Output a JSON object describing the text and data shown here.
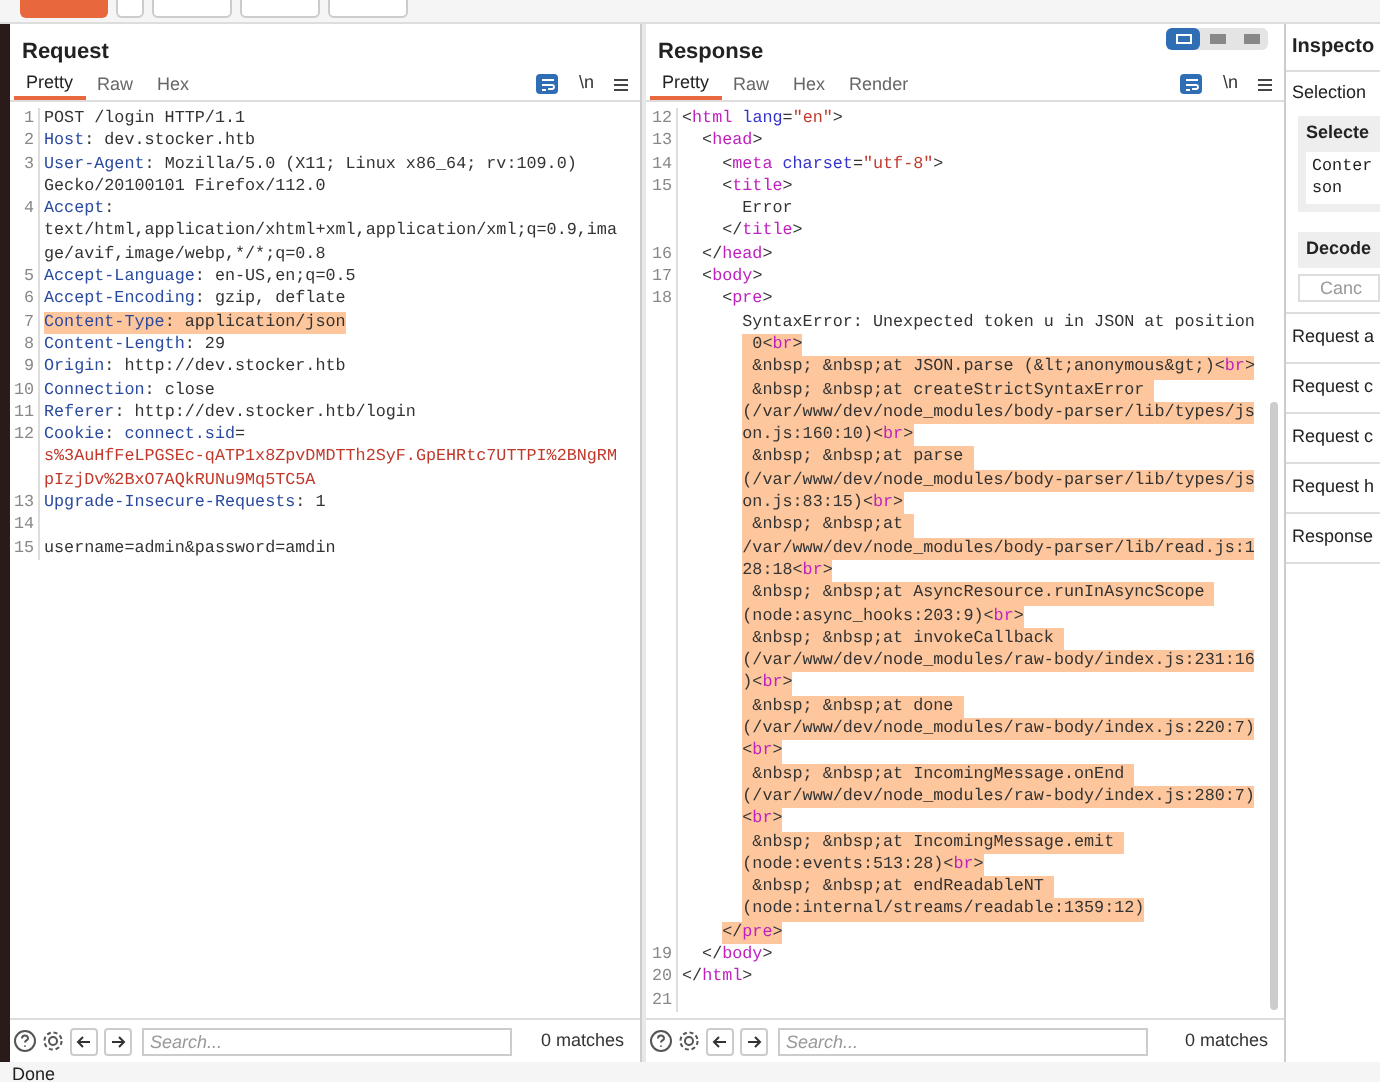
{
  "toolbar": {
    "buttons": [
      {
        "kind": "primary"
      },
      {
        "kind": "gear"
      },
      {
        "kind": "plain"
      },
      {
        "kind": "plain"
      },
      {
        "kind": "plain"
      }
    ]
  },
  "request": {
    "title": "Request",
    "tabs": [
      {
        "label": "Pretty",
        "selected": true
      },
      {
        "label": "Raw",
        "selected": false
      },
      {
        "label": "Hex",
        "selected": false
      }
    ],
    "wrap_on": true,
    "newline_label": "\\n",
    "rows": [
      {
        "n": "1",
        "hl": false,
        "seg": [
          {
            "text": "POST /login HTTP/1.1",
            "kind": "plain"
          }
        ]
      },
      {
        "n": "2",
        "hl": false,
        "seg": [
          {
            "text": "Host",
            "kind": "key"
          },
          {
            "text": ": dev.stocker.htb",
            "kind": "plain"
          }
        ]
      },
      {
        "n": "3",
        "hl": false,
        "seg": [
          {
            "text": "User-Agent",
            "kind": "key"
          },
          {
            "text": ": Mozilla/5.0 (X11; Linux x86_64; rv:109.0)",
            "kind": "plain"
          }
        ]
      },
      {
        "hl": false,
        "seg": [
          {
            "text": "Gecko/20100101 Firefox/112.0",
            "kind": "plain"
          }
        ]
      },
      {
        "n": "4",
        "hl": false,
        "seg": [
          {
            "text": "Accept",
            "kind": "key"
          },
          {
            "text": ":",
            "kind": "plain"
          }
        ]
      },
      {
        "hl": false,
        "seg": [
          {
            "text": "text/html,application/xhtml+xml,application/xml;q=0.9,ima",
            "kind": "plain"
          }
        ]
      },
      {
        "hl": false,
        "seg": [
          {
            "text": "ge/avif,image/webp,*/*;q=0.8",
            "kind": "plain"
          }
        ]
      },
      {
        "n": "5",
        "hl": false,
        "seg": [
          {
            "text": "Accept-Language",
            "kind": "key"
          },
          {
            "text": ": en-US,en;q=0.5",
            "kind": "plain"
          }
        ]
      },
      {
        "n": "6",
        "hl": false,
        "seg": [
          {
            "text": "Accept-Encoding",
            "kind": "key"
          },
          {
            "text": ": gzip, deflate",
            "kind": "plain"
          }
        ]
      },
      {
        "n": "7",
        "hl": true,
        "seg": [
          {
            "text": "Content-Type",
            "kind": "key"
          },
          {
            "text": ": application/json",
            "kind": "plain"
          }
        ]
      },
      {
        "n": "8",
        "hl": false,
        "seg": [
          {
            "text": "Content-Length",
            "kind": "key"
          },
          {
            "text": ": 29",
            "kind": "plain"
          }
        ]
      },
      {
        "n": "9",
        "hl": false,
        "seg": [
          {
            "text": "Origin",
            "kind": "key"
          },
          {
            "text": ": http://dev.stocker.htb",
            "kind": "plain"
          }
        ]
      },
      {
        "n": "10",
        "hl": false,
        "seg": [
          {
            "text": "Connection",
            "kind": "key"
          },
          {
            "text": ": close",
            "kind": "plain"
          }
        ]
      },
      {
        "n": "11",
        "hl": false,
        "seg": [
          {
            "text": "Referer",
            "kind": "key"
          },
          {
            "text": ": http://dev.stocker.htb/login",
            "kind": "plain"
          }
        ]
      },
      {
        "n": "12",
        "hl": false,
        "seg": [
          {
            "text": "Cookie",
            "kind": "key"
          },
          {
            "text": ": ",
            "kind": "plain"
          },
          {
            "text": "connect.sid",
            "kind": "key"
          },
          {
            "text": "=",
            "kind": "plain"
          }
        ]
      },
      {
        "hl": false,
        "seg": [
          {
            "text": "s%3AuHfFeLPGSEc-qATP1x8ZpvDMDTTh2SyF.GpEHRtc7UTTPI%2BNgRM",
            "kind": "value"
          }
        ]
      },
      {
        "hl": false,
        "seg": [
          {
            "text": "pIzjDv%2BxO7AQkRUNu9Mq5TC5A",
            "kind": "value"
          }
        ]
      },
      {
        "n": "13",
        "hl": false,
        "seg": [
          {
            "text": "Upgrade-Insecure-Requests",
            "kind": "key"
          },
          {
            "text": ": 1",
            "kind": "plain"
          }
        ]
      },
      {
        "n": "14",
        "hl": false,
        "seg": []
      },
      {
        "n": "15",
        "hl": false,
        "seg": [
          {
            "text": "username=admin&password=amdin",
            "kind": "plain"
          }
        ]
      }
    ],
    "search": {
      "placeholder": "Search...",
      "matches": "0 matches"
    }
  },
  "response": {
    "title": "Response",
    "layout_buttons": [
      {
        "selected": true
      },
      {
        "selected": false
      },
      {
        "selected": false
      }
    ],
    "tabs": [
      {
        "label": "Pretty",
        "selected": true
      },
      {
        "label": "Raw",
        "selected": false
      },
      {
        "label": "Hex",
        "selected": false
      },
      {
        "label": "Render",
        "selected": false
      }
    ],
    "wrap_on": true,
    "newline_label": "\\n",
    "rows": [
      {
        "n": "12",
        "hl": false,
        "seg": [
          {
            "text": "<",
            "kind": "plain"
          },
          {
            "text": "html",
            "kind": "tag"
          },
          {
            "text": " lang",
            "kind": "attr"
          },
          {
            "text": "=",
            "kind": "plain"
          },
          {
            "text": "\"en\"",
            "kind": "string"
          },
          {
            "text": ">",
            "kind": "plain"
          }
        ],
        "children": [
          {
            "n": "13",
            "hl": false,
            "seg": [
              {
                "text": "<",
                "kind": "plain"
              },
              {
                "text": "head",
                "kind": "tag"
              },
              {
                "text": ">",
                "kind": "plain"
              }
            ],
            "children": [
              {
                "n": "14",
                "hl": false,
                "seg": [
                  {
                    "text": "<",
                    "kind": "plain"
                  },
                  {
                    "text": "meta",
                    "kind": "tag"
                  },
                  {
                    "text": " charset",
                    "kind": "attr"
                  },
                  {
                    "text": "=",
                    "kind": "plain"
                  },
                  {
                    "text": "\"utf-8\"",
                    "kind": "string"
                  },
                  {
                    "text": ">",
                    "kind": "plain"
                  }
                ]
              },
              {
                "n": "15",
                "hl": false,
                "seg": [
                  {
                    "text": "<",
                    "kind": "plain"
                  },
                  {
                    "text": "title",
                    "kind": "tag"
                  },
                  {
                    "text": ">",
                    "kind": "plain"
                  }
                ],
                "children": [
                  {
                    "hl": false,
                    "seg": [
                      {
                        "text": "Error",
                        "kind": "plain"
                      }
                    ]
                  }
                ]
              },
              {
                "hl": false,
                "seg": [
                  {
                    "text": "</",
                    "kind": "plain"
                  },
                  {
                    "text": "title",
                    "kind": "tag"
                  },
                  {
                    "text": ">",
                    "kind": "plain"
                  }
                ]
              }
            ]
          },
          {
            "n": "16",
            "hl": false,
            "seg": [
              {
                "text": "</",
                "kind": "plain"
              },
              {
                "text": "head",
                "kind": "tag"
              },
              {
                "text": ">",
                "kind": "plain"
              }
            ]
          },
          {
            "n": "17",
            "hl": false,
            "seg": [
              {
                "text": "<",
                "kind": "plain"
              },
              {
                "text": "body",
                "kind": "tag"
              },
              {
                "text": ">",
                "kind": "plain"
              }
            ],
            "children": [
              {
                "n": "18",
                "hl": false,
                "seg": [
                  {
                    "text": "<",
                    "kind": "plain"
                  },
                  {
                    "text": "pre",
                    "kind": "tag"
                  },
                  {
                    "text": ">",
                    "kind": "plain"
                  }
                ],
                "children": [
                  {
                    "hl": false,
                    "seg": [
                      {
                        "text": "SyntaxError: Unexpected token u in JSON at position",
                        "kind": "plain"
                      }
                    ]
                  },
                  {
                    "hl": true,
                    "seg": [
                      {
                        "text": " 0<",
                        "kind": "plain"
                      },
                      {
                        "text": "br",
                        "kind": "tag"
                      },
                      {
                        "text": ">",
                        "kind": "plain"
                      }
                    ]
                  },
                  {
                    "hl": true,
                    "seg": [
                      {
                        "text": " &nbsp; &nbsp;at JSON.parse (&lt;anonymous&gt;)<",
                        "kind": "plain"
                      },
                      {
                        "text": "br",
                        "kind": "tag"
                      },
                      {
                        "text": ">",
                        "kind": "plain"
                      }
                    ]
                  },
                  {
                    "hl": true,
                    "seg": [
                      {
                        "text": " &nbsp; &nbsp;at createStrictSyntaxError ",
                        "kind": "plain"
                      }
                    ]
                  },
                  {
                    "hl": true,
                    "seg": [
                      {
                        "text": "(/var/www/dev/node_modules/body-parser/lib/types/js",
                        "kind": "plain"
                      }
                    ]
                  },
                  {
                    "hl": true,
                    "seg": [
                      {
                        "text": "on.js:160:10)<",
                        "kind": "plain"
                      },
                      {
                        "text": "br",
                        "kind": "tag"
                      },
                      {
                        "text": ">",
                        "kind": "plain"
                      }
                    ]
                  },
                  {
                    "hl": true,
                    "seg": [
                      {
                        "text": " &nbsp; &nbsp;at parse ",
                        "kind": "plain"
                      }
                    ]
                  },
                  {
                    "hl": true,
                    "seg": [
                      {
                        "text": "(/var/www/dev/node_modules/body-parser/lib/types/js",
                        "kind": "plain"
                      }
                    ]
                  },
                  {
                    "hl": true,
                    "seg": [
                      {
                        "text": "on.js:83:15)<",
                        "kind": "plain"
                      },
                      {
                        "text": "br",
                        "kind": "tag"
                      },
                      {
                        "text": ">",
                        "kind": "plain"
                      }
                    ]
                  },
                  {
                    "hl": true,
                    "seg": [
                      {
                        "text": " &nbsp; &nbsp;at ",
                        "kind": "plain"
                      }
                    ]
                  },
                  {
                    "hl": true,
                    "seg": [
                      {
                        "text": "/var/www/dev/node_modules/body-parser/lib/read.js:1",
                        "kind": "plain"
                      }
                    ]
                  },
                  {
                    "hl": true,
                    "seg": [
                      {
                        "text": "28:18<",
                        "kind": "plain"
                      },
                      {
                        "text": "br",
                        "kind": "tag"
                      },
                      {
                        "text": ">",
                        "kind": "plain"
                      }
                    ]
                  },
                  {
                    "hl": true,
                    "seg": [
                      {
                        "text": " &nbsp; &nbsp;at AsyncResource.runInAsyncScope ",
                        "kind": "plain"
                      }
                    ]
                  },
                  {
                    "hl": true,
                    "seg": [
                      {
                        "text": "(node:async_hooks:203:9)<",
                        "kind": "plain"
                      },
                      {
                        "text": "br",
                        "kind": "tag"
                      },
                      {
                        "text": ">",
                        "kind": "plain"
                      }
                    ]
                  },
                  {
                    "hl": true,
                    "seg": [
                      {
                        "text": " &nbsp; &nbsp;at invokeCallback ",
                        "kind": "plain"
                      }
                    ]
                  },
                  {
                    "hl": true,
                    "seg": [
                      {
                        "text": "(/var/www/dev/node_modules/raw-body/index.js:231:16",
                        "kind": "plain"
                      }
                    ]
                  },
                  {
                    "hl": true,
                    "seg": [
                      {
                        "text": ")<",
                        "kind": "plain"
                      },
                      {
                        "text": "br",
                        "kind": "tag"
                      },
                      {
                        "text": ">",
                        "kind": "plain"
                      }
                    ]
                  },
                  {
                    "hl": true,
                    "seg": [
                      {
                        "text": " &nbsp; &nbsp;at done ",
                        "kind": "plain"
                      }
                    ]
                  },
                  {
                    "hl": true,
                    "seg": [
                      {
                        "text": "(/var/www/dev/node_modules/raw-body/index.js:220:7)",
                        "kind": "plain"
                      }
                    ]
                  },
                  {
                    "hl": true,
                    "seg": [
                      {
                        "text": "<",
                        "kind": "plain"
                      },
                      {
                        "text": "br",
                        "kind": "tag"
                      },
                      {
                        "text": ">",
                        "kind": "plain"
                      }
                    ]
                  },
                  {
                    "hl": true,
                    "seg": [
                      {
                        "text": " &nbsp; &nbsp;at IncomingMessage.onEnd ",
                        "kind": "plain"
                      }
                    ]
                  },
                  {
                    "hl": true,
                    "seg": [
                      {
                        "text": "(/var/www/dev/node_modules/raw-body/index.js:280:7)",
                        "kind": "plain"
                      }
                    ]
                  },
                  {
                    "hl": true,
                    "seg": [
                      {
                        "text": "<",
                        "kind": "plain"
                      },
                      {
                        "text": "br",
                        "kind": "tag"
                      },
                      {
                        "text": ">",
                        "kind": "plain"
                      }
                    ]
                  },
                  {
                    "hl": true,
                    "seg": [
                      {
                        "text": " &nbsp; &nbsp;at IncomingMessage.emit ",
                        "kind": "plain"
                      }
                    ]
                  },
                  {
                    "hl": true,
                    "seg": [
                      {
                        "text": "(node:events:513:28)<",
                        "kind": "plain"
                      },
                      {
                        "text": "br",
                        "kind": "tag"
                      },
                      {
                        "text": ">",
                        "kind": "plain"
                      }
                    ]
                  },
                  {
                    "hl": true,
                    "seg": [
                      {
                        "text": " &nbsp; &nbsp;at endReadableNT ",
                        "kind": "plain"
                      }
                    ]
                  },
                  {
                    "hl": true,
                    "seg": [
                      {
                        "text": "(node:internal/streams/readable:1359:12)",
                        "kind": "plain"
                      }
                    ]
                  }
                ]
              },
              {
                "hl": true,
                "seg": [
                  {
                    "text": "</",
                    "kind": "plain"
                  },
                  {
                    "text": "pre",
                    "kind": "tag"
                  },
                  {
                    "text": ">",
                    "kind": "plain"
                  }
                ]
              }
            ]
          },
          {
            "n": "19",
            "hl": false,
            "seg": [
              {
                "text": "</",
                "kind": "plain"
              },
              {
                "text": "body",
                "kind": "tag"
              },
              {
                "text": ">",
                "kind": "plain"
              }
            ]
          }
        ]
      },
      {
        "n": "20",
        "hl": false,
        "seg": [
          {
            "text": "</",
            "kind": "plain"
          },
          {
            "text": "html",
            "kind": "tag"
          },
          {
            "text": ">",
            "kind": "plain"
          }
        ]
      },
      {
        "n": "21",
        "hl": false,
        "seg": []
      }
    ],
    "search": {
      "placeholder": "Search...",
      "matches": "0 matches"
    }
  },
  "inspector": {
    "title": "Inspecto",
    "selection_label": "Selection",
    "selected_header": "Selecte",
    "selected_text": [
      "Conter",
      "son"
    ],
    "decoded_header": "Decode",
    "cancel_button": "Canc",
    "sections": [
      "Request a",
      "Request c",
      "Request c",
      "Request h",
      "Response"
    ]
  },
  "status_bar": {
    "text": "Done"
  }
}
